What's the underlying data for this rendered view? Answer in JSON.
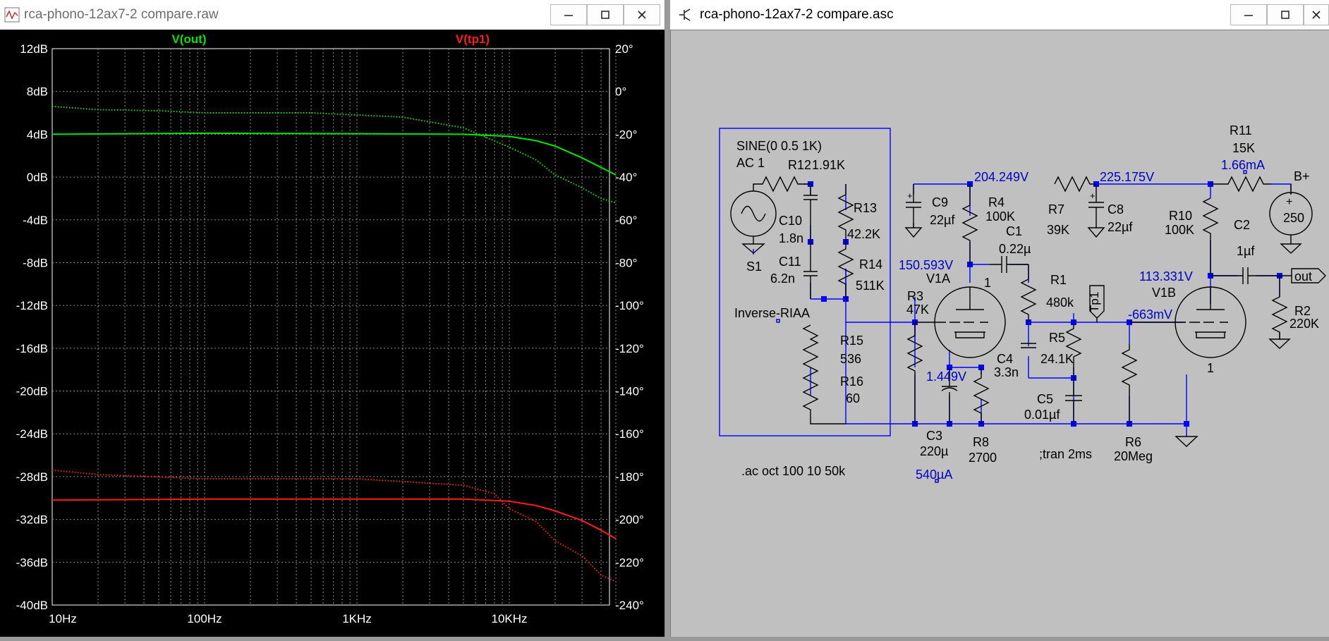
{
  "plot_window": {
    "title": "rca-phono-12ax7-2 compare.raw",
    "icon": "waveform-icon",
    "controls": [
      "minimize-icon",
      "maximize-icon",
      "close-icon"
    ]
  },
  "schematic_window": {
    "title": "rca-phono-12ax7-2 compare.asc",
    "icon": "schematic-icon",
    "controls": [
      "minimize-icon",
      "maximize-icon",
      "close-icon"
    ]
  },
  "chart_data": {
    "type": "line",
    "x_scale": "log",
    "xlim": [
      10,
      50000
    ],
    "x_ticks": [
      "10Hz",
      "100Hz",
      "1KHz",
      "10KHz"
    ],
    "left_axis": {
      "unit": "dB",
      "ylim": [
        -40,
        12
      ],
      "ticks": [
        "12dB",
        "8dB",
        "4dB",
        "0dB",
        "-4dB",
        "-8dB",
        "-12dB",
        "-16dB",
        "-20dB",
        "-24dB",
        "-28dB",
        "-32dB",
        "-36dB",
        "-40dB"
      ]
    },
    "right_axis": {
      "unit": "degrees",
      "ylim": [
        -240,
        20
      ],
      "ticks": [
        "20°",
        "0°",
        "-20°",
        "-40°",
        "-60°",
        "-80°",
        "-100°",
        "-120°",
        "-140°",
        "-160°",
        "-180°",
        "-200°",
        "-220°",
        "-240°"
      ]
    },
    "grid": true,
    "background": "#000000",
    "series": [
      {
        "name": "V(out)",
        "color": "#00e600",
        "style": "solid",
        "axis": "dB",
        "x": [
          10,
          100,
          1000,
          5000,
          10000,
          15000,
          20000,
          30000,
          40000,
          50000
        ],
        "y": [
          4.0,
          4.1,
          4.05,
          4.0,
          3.8,
          3.4,
          2.9,
          1.8,
          0.9,
          0.2
        ]
      },
      {
        "name": "V(out)",
        "color": "#00e600",
        "style": "dotted",
        "axis": "deg",
        "x": [
          10,
          20,
          50,
          100,
          500,
          1000,
          2000,
          5000,
          10000,
          15000,
          20000,
          30000,
          40000,
          50000
        ],
        "y": [
          -7,
          -8.5,
          -9,
          -10,
          -10,
          -11,
          -12,
          -17,
          -26,
          -32,
          -39,
          -45,
          -50,
          -52
        ]
      },
      {
        "name": "V(tp1)",
        "color": "#ff1a1a",
        "style": "solid",
        "axis": "dB",
        "x": [
          10,
          100,
          1000,
          5000,
          10000,
          15000,
          20000,
          30000,
          40000,
          50000
        ],
        "y": [
          -30.2,
          -30.1,
          -30.1,
          -30.1,
          -30.3,
          -30.7,
          -31.2,
          -32.1,
          -33.0,
          -33.8
        ]
      },
      {
        "name": "V(tp1)",
        "color": "#ff1a1a",
        "style": "dotted",
        "axis": "deg",
        "x": [
          10,
          20,
          100,
          1000,
          5000,
          8000,
          10000,
          15000,
          20000,
          30000,
          40000,
          50000
        ],
        "y": [
          -177,
          -179,
          -181,
          -181,
          -184,
          -188,
          -195,
          -201,
          -210,
          -217,
          -226,
          -229
        ]
      }
    ]
  },
  "schematic": {
    "colors": {
      "wire": "#0000ff",
      "component": "#000000",
      "node_label": "#0000c8",
      "background": "#c0c0c0"
    },
    "labels": {
      "sine": "SINE(0 0.5 1K)",
      "ac": "AC 1",
      "s1": "S1",
      "r12": "R12",
      "r12v": "1.91K",
      "r13": "R13",
      "r13v": "42.2K",
      "c10": "C10",
      "c10v": "1.8n",
      "r14": "R14",
      "r14v": "511K",
      "c11": "C11",
      "c11v": "6.2n",
      "inverse": "Inverse-RIAA",
      "r15": "R15",
      "r15v": "536",
      "r16": "R16",
      "r16v": "60",
      "c9": "C9",
      "c9v": "22µf",
      "r4": "R4",
      "r4v": "100K",
      "n204": "204.249V",
      "r7": "R7",
      "r7v": "39K",
      "n225": "225.175V",
      "c8": "C8",
      "c8v": "22µf",
      "r11": "R11",
      "r11v": "15K",
      "i166": "1.66mA",
      "bplus": "B+",
      "bplusv": "250",
      "r10": "R10",
      "r10v": "100K",
      "c2": "C2",
      "c2v": "1µf",
      "c1": "C1",
      "c1v": "0.22µ",
      "n150": "150.593V",
      "v1a": "V1A",
      "one_a": "1",
      "r1": "R1",
      "r1v": "480k",
      "tp1": "Tp1",
      "n113": "113.331V",
      "v1b": "V1B",
      "out": "out",
      "r2": "R2",
      "r2v": "220K",
      "r3": "R3",
      "r3v": "47K",
      "r5": "R5",
      "r5v": "24.1K",
      "n663": "-663mV",
      "one_b": "1",
      "c4": "C4",
      "c4v": "3.3n",
      "n1449": "1.449V",
      "c5": "C5",
      "c5v": "0.01µf",
      "c3": "C3",
      "c3v": "220µ",
      "r8": "R8",
      "r8v": "2700",
      "tran": ";tran 2ms",
      "r6": "R6",
      "r6v": "20Meg",
      "ac_dir": ".ac oct 100 10 50k",
      "i540": "540µA"
    }
  }
}
